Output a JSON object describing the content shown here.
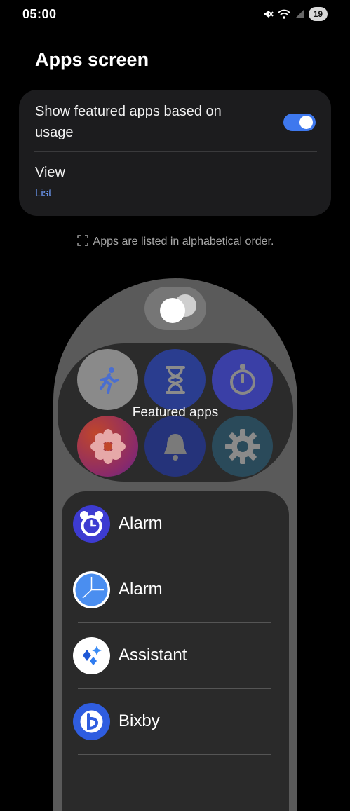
{
  "status_bar": {
    "time": "05:00",
    "battery": "19",
    "icons": [
      "mute-icon",
      "wifi-icon",
      "signal-icon"
    ]
  },
  "page": {
    "title": "Apps screen"
  },
  "settings": {
    "featured": {
      "label": "Show featured apps based on usage",
      "enabled": true
    },
    "view": {
      "label": "View",
      "value": "List"
    }
  },
  "info": {
    "text": "Apps are listed in alphabetical order."
  },
  "preview": {
    "featured_label": "Featured apps",
    "featured_icons": [
      "running-person-icon",
      "hourglass-icon",
      "stopwatch-icon",
      "flower-icon",
      "bell-icon",
      "gear-icon"
    ],
    "apps": [
      {
        "label": "Alarm",
        "icon": "alarm-clock-icon"
      },
      {
        "label": "Alarm",
        "icon": "clock-icon"
      },
      {
        "label": "Assistant",
        "icon": "assistant-icon"
      },
      {
        "label": "Bixby",
        "icon": "bixby-icon"
      }
    ]
  },
  "colors": {
    "accent": "#3e78ee",
    "link": "#6e9bf7",
    "card": "#1c1c1e"
  }
}
